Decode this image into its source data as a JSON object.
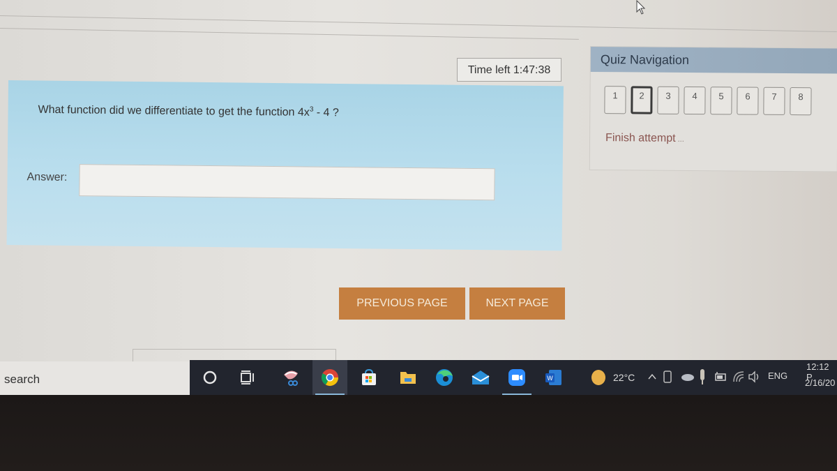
{
  "timer": {
    "label": "Time left 1:47:38"
  },
  "question": {
    "text_prefix": "What function did we differentiate to get the function 4x",
    "exponent": "3",
    "text_suffix": " - 4 ?",
    "answer_label": "Answer:",
    "answer_value": "",
    "answer_placeholder": ""
  },
  "quiz_navigation": {
    "title": "Quiz Navigation",
    "questions": [
      "1",
      "2",
      "3",
      "4",
      "5",
      "6",
      "7",
      "8"
    ],
    "current_question": "2",
    "finish_label": "Finish attempt",
    "finish_dots": " ..."
  },
  "buttons": {
    "previous": "PREVIOUS PAGE",
    "next": "NEXT PAGE"
  },
  "taskbar": {
    "search_text": "search",
    "pinned_apps": [
      "cortana",
      "task-view",
      "snip-sketch",
      "chrome",
      "microsoft-store",
      "file-explorer",
      "edge",
      "mail",
      "zoom",
      "word"
    ],
    "active_apps": [
      "chrome",
      "zoom"
    ],
    "weather_temp": "22°C",
    "language": "ENG",
    "time": "12:12 P",
    "date": "2/16/20"
  },
  "colors": {
    "question_bg": "#b8dded",
    "nav_header": "#9fb2c4",
    "button_bg": "#c57f40",
    "taskbar_bg": "#22252e",
    "finish_link": "#8a5550"
  }
}
